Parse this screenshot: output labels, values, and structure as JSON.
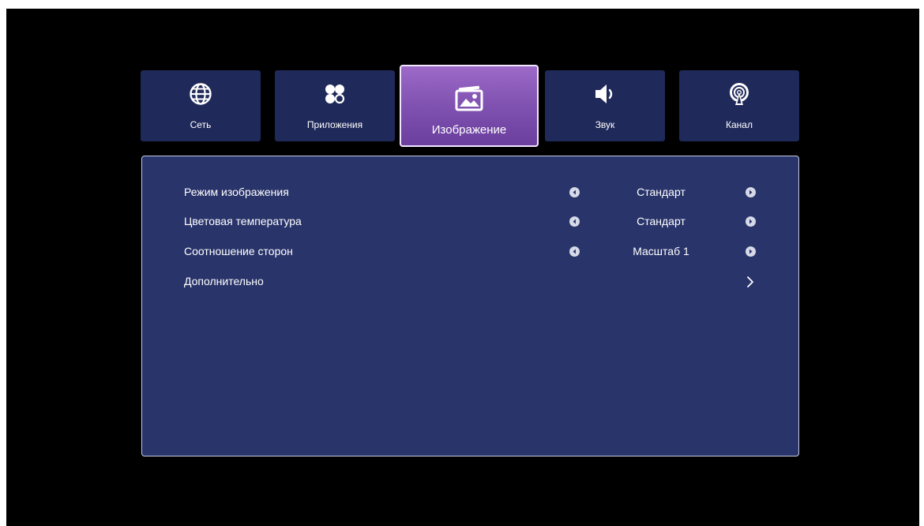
{
  "tabs": [
    {
      "id": "network",
      "label": "Сеть",
      "icon": "globe-icon",
      "active": false
    },
    {
      "id": "apps",
      "label": "Приложения",
      "icon": "apps-icon",
      "active": false
    },
    {
      "id": "picture",
      "label": "Изображение",
      "icon": "picture-icon",
      "active": true
    },
    {
      "id": "sound",
      "label": "Звук",
      "icon": "speaker-icon",
      "active": false
    },
    {
      "id": "channel",
      "label": "Канал",
      "icon": "antenna-icon",
      "active": false
    }
  ],
  "settings": [
    {
      "label": "Режим изображения",
      "value": "Стандарт"
    },
    {
      "label": "Цветовая температура",
      "value": "Стандарт"
    },
    {
      "label": "Соотношение сторон",
      "value": "Масштаб 1"
    },
    {
      "label": "Дополнительно",
      "value": ""
    }
  ],
  "colors": {
    "background": "#000000",
    "tab": "#202a5a",
    "active_tab": "#8a58bb",
    "panel": "#29346a"
  }
}
